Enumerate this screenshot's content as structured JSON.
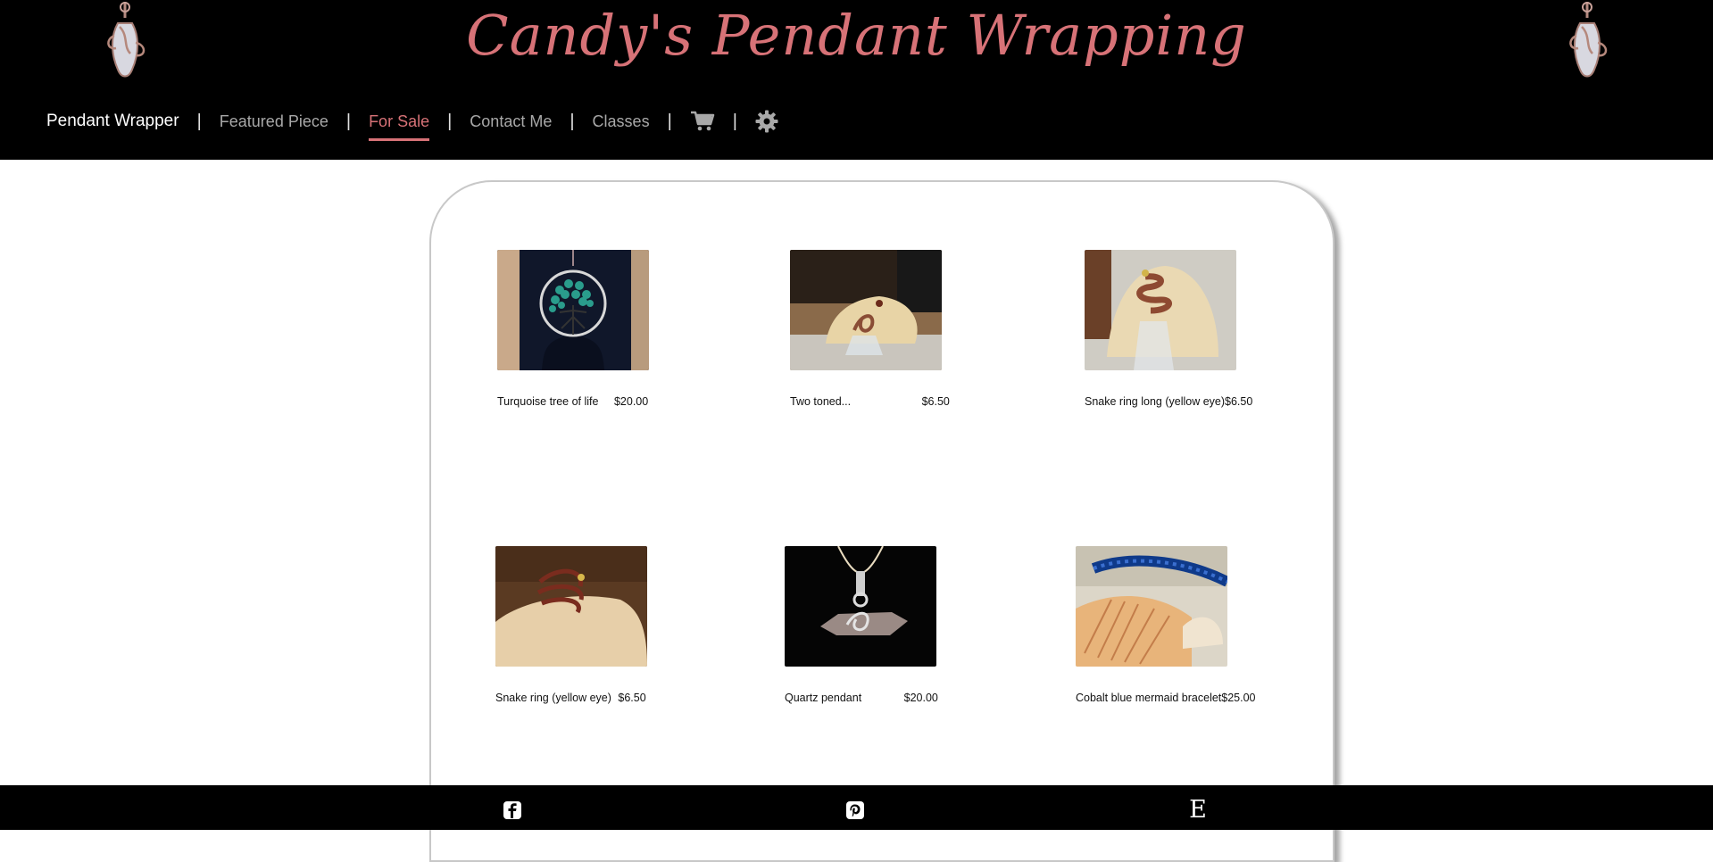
{
  "site": {
    "title": "Candy's Pendant Wrapping"
  },
  "nav": {
    "brand": "Pendant Wrapper",
    "items": [
      {
        "label": "Featured Piece"
      },
      {
        "label": "For Sale",
        "active": true
      },
      {
        "label": "Contact Me"
      },
      {
        "label": "Classes"
      }
    ],
    "separator": "|",
    "cart_icon": "shopping-cart-icon",
    "settings_icon": "gear-icon"
  },
  "products": [
    {
      "name": "Turquoise tree of life",
      "price": "$20.00"
    },
    {
      "name": "Two toned...",
      "price": "$6.50"
    },
    {
      "name": "Snake ring long (yellow eye)",
      "price": "$6.50"
    },
    {
      "name": "Snake ring (yellow eye)",
      "price": "$6.50"
    },
    {
      "name": "Quartz pendant",
      "price": "$20.00"
    },
    {
      "name": "Cobalt blue mermaid bracelet",
      "price": "$25.00"
    }
  ],
  "footer": {
    "icons": [
      "facebook-icon",
      "pinterest-icon",
      "etsy-icon"
    ],
    "etsy_letter": "E"
  },
  "colors": {
    "accent": "#d77277",
    "header_bg": "#000000",
    "nav_text": "#a8a8a8"
  }
}
